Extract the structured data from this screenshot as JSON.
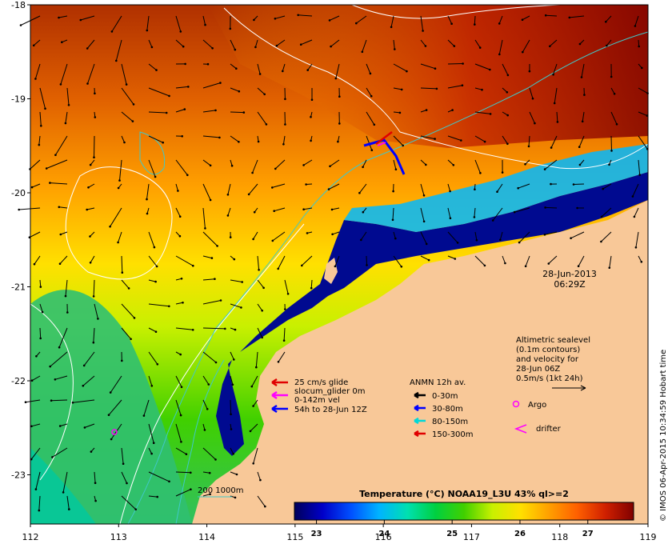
{
  "map": {
    "x_ticks": [
      "112",
      "113",
      "114",
      "115",
      "116",
      "117",
      "118",
      "119"
    ],
    "y_ticks": [
      "-18",
      "-19",
      "-20",
      "-21",
      "-22",
      "-23"
    ]
  },
  "datetime": {
    "date": "28-Jun-2013",
    "time": "06:29Z"
  },
  "glider_legend": {
    "line1": "25 cm/s glide",
    "line2": "slocum_glider 0m",
    "line3": "0-142m vel",
    "line4": "54h to 28-Jun 12Z"
  },
  "anmn_legend": {
    "title": "ANMN 12h av.",
    "items": [
      {
        "label": "0-30m",
        "color": "#000000"
      },
      {
        "label": "30-80m",
        "color": "#0000ff"
      },
      {
        "label": "80-150m",
        "color": "#00d8d8"
      },
      {
        "label": "150-300m",
        "color": "#e00000"
      }
    ]
  },
  "altimetric_legend": {
    "lines": [
      "Altimetric sealevel",
      "(0.1m contours)",
      "and velocity for",
      "28-Jun 06Z",
      "0.5m/s (1kt 24h)"
    ]
  },
  "argo_label": "Argo",
  "drifter_label": "drifter",
  "depth_label": "200 1000m",
  "colorbar": {
    "title": "Temperature (°C) NOAA19_L3U 43% ql>=2",
    "ticks": [
      "23",
      "24",
      "25",
      "26",
      "27"
    ],
    "stops": [
      "#00005a",
      "#0000c8",
      "#0050ff",
      "#00b4ff",
      "#00e0b0",
      "#00d040",
      "#40d000",
      "#c8f000",
      "#ffe000",
      "#ffa000",
      "#ff6000",
      "#d02000",
      "#800000"
    ]
  },
  "credit": "© IMOS 06-Apr-2015 10:34:59 Hobart time",
  "colors": {
    "land": "#f8c898",
    "sea_deep": "#000a90",
    "contour": "#ffffff",
    "isobath": "#40c8c8"
  }
}
